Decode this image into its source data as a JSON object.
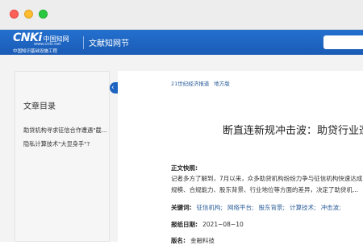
{
  "header": {
    "logo_text": "CNKi",
    "logo_cn": "中国知网",
    "logo_url": "www.cnki.net",
    "logo_subtitle": "中国知识基础设施工程",
    "title": "文献知网节"
  },
  "sidebar": {
    "title": "文章目录",
    "items": [
      {
        "label": "助贷机构寻求征信合作遭遇\"截..."
      },
      {
        "label": "隐私计算技术\"大显身手\"?"
      }
    ]
  },
  "article": {
    "source": "21世纪经济报道",
    "source_extra": "地方版",
    "title": "断直连新规冲击波：助贷行业遭",
    "abstract_label": "正文快照:",
    "abstract_lines": [
      "记者多方了解到，7月以来，众多助贷机构纷纷力争与征信机构快速达成",
      "规模、合规能力、股东背景、行业地位等方面的差异，决定了助贷机..."
    ],
    "keywords_label": "关键词:",
    "keywords": [
      "征信机构;",
      "网络平台;",
      "股东背景;",
      "计算技术;",
      "冲击波;"
    ],
    "date_label": "报纸日期:",
    "date_value": "2021−08−10",
    "column_label": "版名:",
    "column_value": "金融科技"
  }
}
